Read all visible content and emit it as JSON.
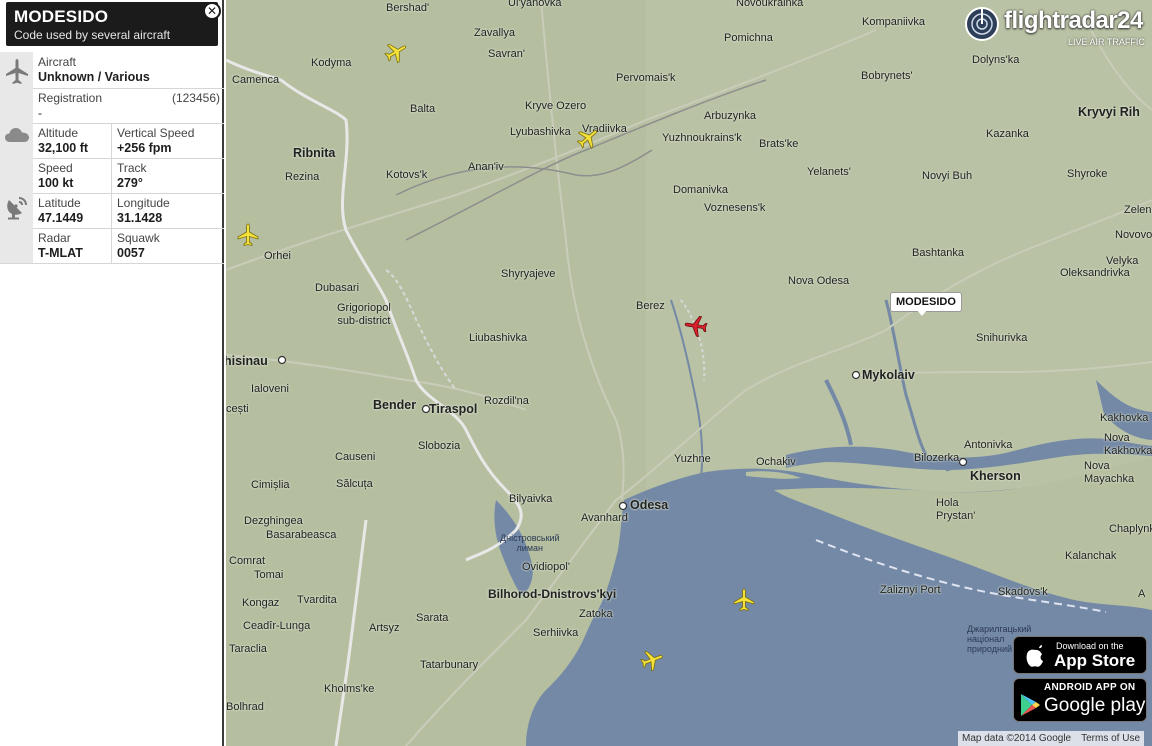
{
  "flight": {
    "callsign": "MODESIDO",
    "subtitle": "Code used by several aircraft",
    "aircraft_label": "Aircraft",
    "aircraft_value": "Unknown / Various",
    "registration_label": "Registration",
    "registration_value": "-",
    "registration_code": "(123456)",
    "altitude_label": "Altitude",
    "altitude_value": "32,100 ft",
    "vspeed_label": "Vertical Speed",
    "vspeed_value": "+256 fpm",
    "speed_label": "Speed",
    "speed_value": "100 kt",
    "track_label": "Track",
    "track_value": "279°",
    "lat_label": "Latitude",
    "lat_value": "47.1449",
    "lon_label": "Longitude",
    "lon_value": "31.1428",
    "radar_label": "Radar",
    "radar_value": "T-MLAT",
    "squawk_label": "Squawk",
    "squawk_value": "0057"
  },
  "icons": {
    "close": "close-icon",
    "aircraft": "airplane-icon",
    "weather": "cloud-icon",
    "radar": "satellite-dish-icon"
  },
  "logo": {
    "name": "flightradar24",
    "tagline": "LIVE AIR TRAFFIC"
  },
  "badges": {
    "appstore_top": "Download on the",
    "appstore_main": "App Store",
    "googleplay_top": "ANDROID APP ON",
    "googleplay_main": "Google play"
  },
  "footer": {
    "map_data": "Map data ©2014 Google",
    "terms": "Terms of Use"
  },
  "map": {
    "selected_label": "MODESIDO",
    "places": [
      "Bershad'",
      "Ul'yanovka",
      "Novoukrainka",
      "Kompaniivka",
      "Dolyns'ka",
      "Pomichna",
      "Kodyma",
      "Zavallya",
      "Savran'",
      "Pervomais'k",
      "Bobrynets'",
      "Camenca",
      "Balta",
      "Kryve Ozero",
      "Arbuzynka",
      "Lyubashivka",
      "Vradiivka",
      "Yuzhnoukrains'k",
      "Brats'ke",
      "Kazanka",
      "Kryvyi Rih",
      "Ribnita",
      "Anan'iv",
      "Rezina",
      "Kotovs'k",
      "Yelanets'",
      "Novyi Buh",
      "Shyroke",
      "Domanivka",
      "Zelene",
      "Voznesens'k",
      "Orhei",
      "Novovo",
      "Bashtanka",
      "Velyka",
      "Shyryajeve",
      "Oleksandrivka",
      "Dubasari",
      "Nova Odesa",
      "Grigoriopol\nsub-district",
      "Berez",
      "Liubashivka",
      "hisinau",
      "Mykolaiv",
      "Snihurivka",
      "Ialoveni",
      "Bender",
      "Tiraspol",
      "Rozdil'na",
      "cești",
      "Kakhovka",
      "Nova\nKakhovka",
      "Antonivka",
      "Slobozia",
      "Causeni",
      "Yuzhne",
      "Ochakiv",
      "Bilozerka",
      "Kherson",
      "Nova\nMayachka",
      "Cimișlia",
      "Sălcuța",
      "Bilyaivka",
      "Odesa",
      "Hola\nPrystan'",
      "Dezghingea",
      "Avanhard",
      "Chaplynka",
      "Basarabeasca",
      "Дністровський\nлиман",
      "Kalanchak",
      "Comrat",
      "Ovidiopol'",
      "Tomai",
      "Bilhorod-Dnistrovs'kyi",
      "Zaliznyi Port",
      "Skadovs'k",
      "Kongaz",
      "Tvardita",
      "Zatoka",
      "Sarata",
      "Ceadîr-Lunga",
      "Artsyz",
      "Serhiivka",
      "Джарилгацький\nнаціонал\nприродний",
      "Taraclia",
      "Tatarbunary",
      "Kholms'ke",
      "Bolhrad",
      "A"
    ]
  }
}
